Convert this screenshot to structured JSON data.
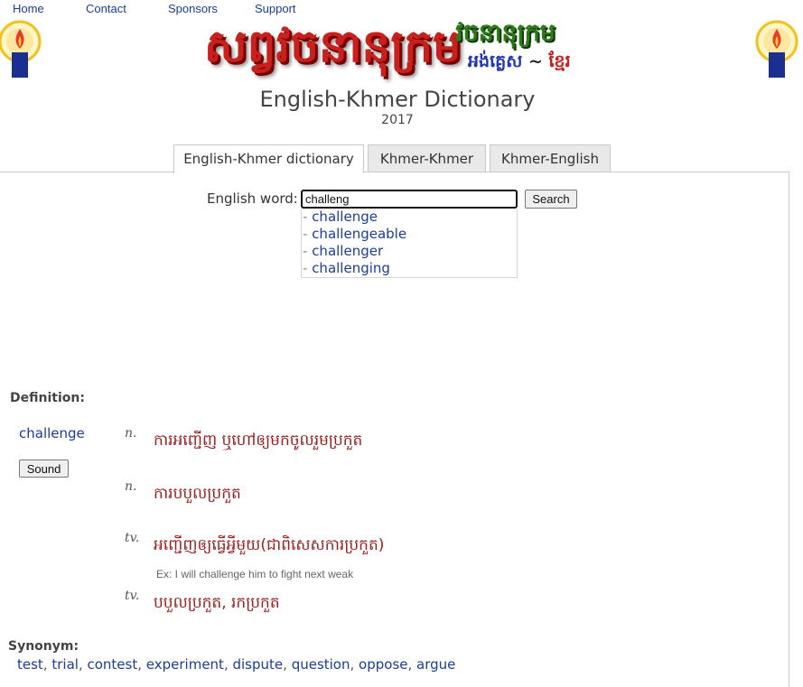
{
  "nav": [
    "Home",
    "Contact",
    "Sponsors",
    "Support"
  ],
  "logo": {
    "main": "សព្វវចនានុក្រម",
    "sub1": "វចនានុក្រម",
    "sub2_en": "អង់គ្លេស",
    "sub2_sep": "~",
    "sub2_kh": "ខ្មែរ"
  },
  "header": {
    "title": "English-Khmer Dictionary",
    "year": "2017"
  },
  "tabs": [
    {
      "label": "English-Khmer dictionary",
      "active": true
    },
    {
      "label": "Khmer-Khmer",
      "active": false
    },
    {
      "label": "Khmer-English",
      "active": false
    }
  ],
  "search": {
    "label": "English word:",
    "value": "challeng",
    "button": "Search",
    "suggestions": [
      "challenge",
      "challengeable",
      "challenger",
      "challenging"
    ]
  },
  "definition": {
    "label": "Definition:",
    "word": "challenge",
    "sound_button": "Sound",
    "entries": [
      {
        "pos": "n.",
        "meaning": "ការអញ្ជើញ ឬហៅឲ្យមកចូលរួមប្រកួត"
      },
      {
        "pos": "n.",
        "meaning": "ការបបួលប្រកួត"
      },
      {
        "pos": "tv.",
        "meaning": "អញ្ជើញឲ្យធ្វើអ្វីមួយ(ជាពិសេសការប្រកួត)"
      },
      {
        "pos": "tv.",
        "meaning": "បបួលប្រកួត, រកប្រកួត"
      }
    ],
    "example": "Ex: I will challenge him to fight next weak"
  },
  "synonyms": {
    "label": "Synonym:",
    "items": [
      "test",
      "trial",
      "contest",
      "experiment",
      "dispute",
      "question",
      "oppose",
      "argue"
    ]
  },
  "colors": {
    "link": "#1a3d9a",
    "meaning": "#9b1b1b",
    "logo_red": "#c8201c",
    "logo_green": "#2c7a18",
    "logo_blue": "#2235b0"
  }
}
